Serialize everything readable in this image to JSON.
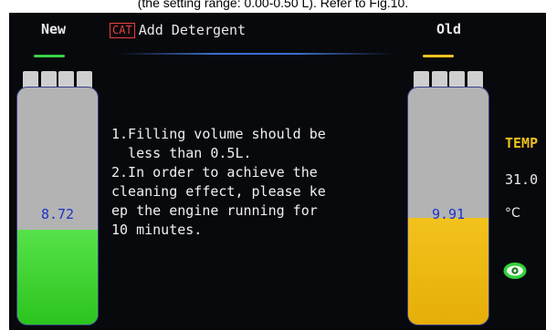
{
  "caption": "(the setting range: 0.00-0.50 L). Refer to Fig.10.",
  "header": {
    "new_label": "New",
    "old_label": "Old",
    "cat_badge": "CAT",
    "title": "Add Detergent"
  },
  "tanks": {
    "new": {
      "value": "8.72",
      "level_fraction": 0.4,
      "color": "#2cc41e"
    },
    "old": {
      "value": "9.91",
      "level_fraction": 0.45,
      "color": "#f0c020"
    }
  },
  "instructions": [
    "1.Filling volume should be",
    "  less than 0.5L.",
    "2.In order to achieve the",
    "cleaning effect, please ke",
    "ep the engine running for",
    "10 minutes."
  ],
  "temperature": {
    "label": "TEMP",
    "value": "31.0",
    "unit": "°C"
  },
  "status_icon": "eye-icon",
  "colors": {
    "background": "#08090c",
    "accent_blue": "#3c6fd0",
    "new_green": "#38d148",
    "old_yellow": "#f0c020",
    "badge_red": "#e84040"
  }
}
